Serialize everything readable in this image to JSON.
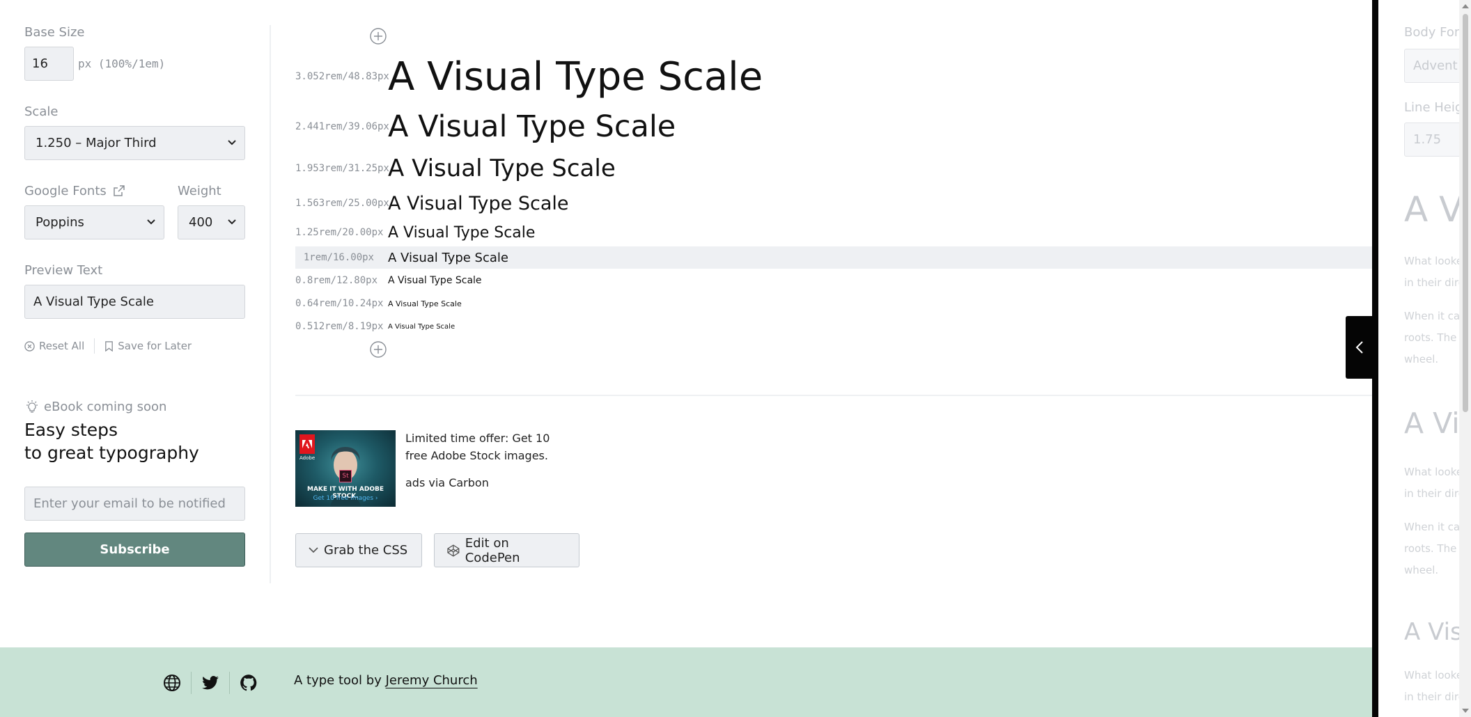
{
  "sidebar": {
    "base_size_label": "Base Size",
    "base_size_value": "16",
    "base_size_hint": "px (100%/1em)",
    "scale_label": "Scale",
    "scale_value": "1.250 – Major Third",
    "google_fonts_label": "Google Fonts",
    "font_value": "Poppins",
    "weight_label": "Weight",
    "weight_value": "400",
    "preview_label": "Preview Text",
    "preview_value": "A Visual Type Scale",
    "reset_label": "Reset All",
    "save_label": "Save for Later",
    "ebook_tag": "eBook coming soon",
    "ebook_title_line1": "Easy steps",
    "ebook_title_line2": "to great typography",
    "email_placeholder": "Enter your email to be notified",
    "subscribe_label": "Subscribe"
  },
  "scale": {
    "sample_text": "A Visual Type Scale",
    "rows": [
      {
        "meta": "3.052rem/48.83px"
      },
      {
        "meta": "2.441rem/39.06px"
      },
      {
        "meta": "1.953rem/31.25px"
      },
      {
        "meta": "1.563rem/25.00px"
      },
      {
        "meta": "1.25rem/20.00px"
      },
      {
        "meta": "1rem/16.00px"
      },
      {
        "meta": "0.8rem/12.80px"
      },
      {
        "meta": "0.64rem/10.24px"
      },
      {
        "meta": "0.512rem/8.19px"
      }
    ]
  },
  "ad": {
    "brand": "Adobe",
    "badge": "St",
    "headline": "MAKE IT WITH ADOBE STOCK.",
    "cta": "Get 10 free images ›",
    "text": "Limited time offer: Get 10 free Adobe Stock images.",
    "via": "ads via Carbon"
  },
  "actions": {
    "grab_css": "Grab the CSS",
    "codepen": "Edit on CodePen"
  },
  "footer": {
    "text_prefix": "A type tool by ",
    "author": "Jeremy Church"
  },
  "right_panel": {
    "body_font_label": "Body Fon",
    "body_font_value": "Advent",
    "line_height_label": "Line Heig",
    "line_height_value": "1.75",
    "heading1": "A V",
    "heading2": "A Vi",
    "heading3": "A Vis",
    "p1_line1": "What looke",
    "p1_line2": "in their dire",
    "p2_line1": "When it car",
    "p2_line2": "roots. The r",
    "p2_line3": "wheel.",
    "p3_line1": "What looke",
    "p3_line2": "in their dire",
    "p4_line1": "When it car",
    "p4_line2": "roots. The r",
    "p4_line3": "wheel.",
    "p5_line1": "What looke",
    "p5_line2": "in their dire"
  }
}
